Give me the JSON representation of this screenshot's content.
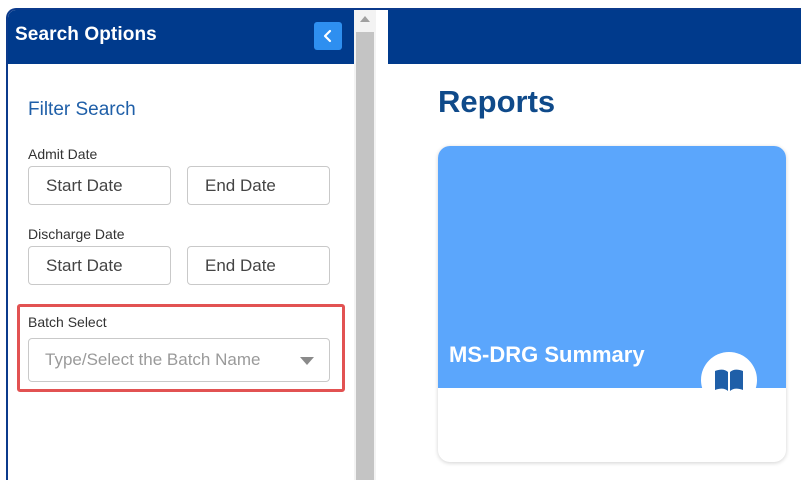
{
  "sidebar": {
    "title": "Search Options",
    "collapse_icon": "chevron-left-icon",
    "filter_title": "Filter Search",
    "admit_date": {
      "label": "Admit Date",
      "start_placeholder": "Start Date",
      "end_placeholder": "End Date"
    },
    "discharge_date": {
      "label": "Discharge Date",
      "start_placeholder": "Start Date",
      "end_placeholder": "End Date"
    },
    "batch_select": {
      "label": "Batch Select",
      "placeholder": "Type/Select the Batch Name"
    }
  },
  "main": {
    "title": "Reports",
    "cards": [
      {
        "title": "MS-DRG Summary",
        "icon": "book-icon"
      }
    ]
  },
  "colors": {
    "header": "#003a8c",
    "accent": "#2e8ff0",
    "card": "#5ba6fc",
    "highlight": "#e25252"
  }
}
